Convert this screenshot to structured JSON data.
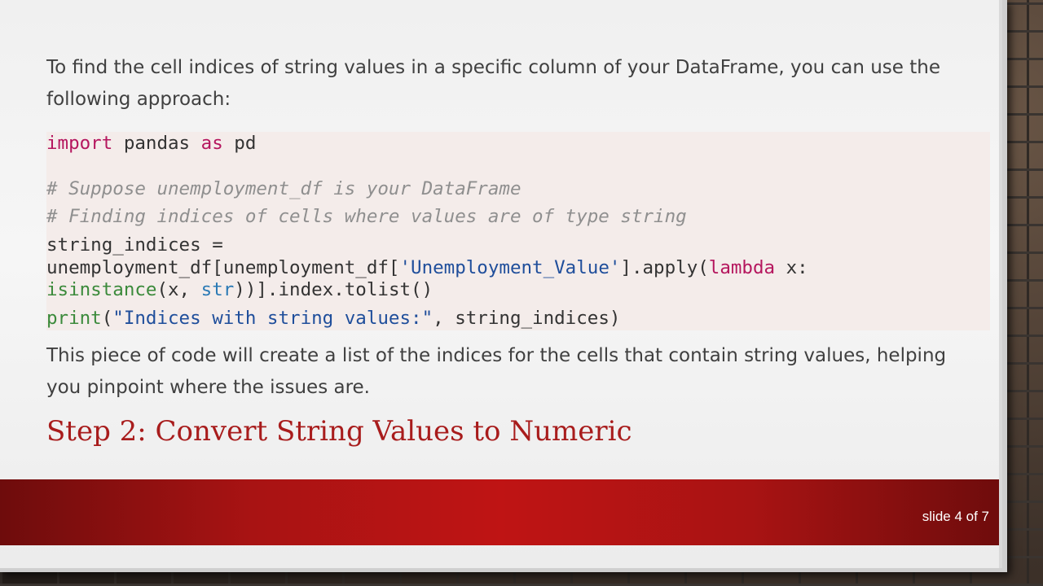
{
  "slide": {
    "intro_text": "To find the cell indices of string values in a specific column of your DataFrame, you can use the following approach:",
    "code": {
      "line1_kw1": "import",
      "line1_mid": " pandas ",
      "line1_kw2": "as",
      "line1_end": " pd",
      "comment1": "# Suppose unemployment_df is your DataFrame",
      "comment2": "# Finding indices of cells where values are of type string",
      "line4": "string_indices =",
      "line5_start": "unemployment_df[unemployment_df[",
      "line5_str": "'Unemployment_Value'",
      "line5_mid": "].apply(",
      "line5_kw": "lambda",
      "line5_end": " x:",
      "line6_bi": "isinstance",
      "line6_mid": "(x, ",
      "line6_ty": "str",
      "line6_end": "))].index.tolist()",
      "line7_bi": "print",
      "line7_open": "(",
      "line7_str": "\"Indices with string values:\"",
      "line7_end": ", string_indices)"
    },
    "outro_text": "This piece of code will create a list of the indices for the cells that contain string values, helping you pinpoint where the issues are.",
    "step_heading": "Step 2: Convert String Values to Numeric",
    "slide_number": "slide 4 of 7"
  },
  "colors": {
    "accent_red": "#a81c1c",
    "footer_red": "#bf1414",
    "code_bg": "#f4ecea",
    "keyword": "#b5165e",
    "string": "#1f4e9b",
    "builtin": "#3b8a3b",
    "comment": "#8f8f8f"
  }
}
